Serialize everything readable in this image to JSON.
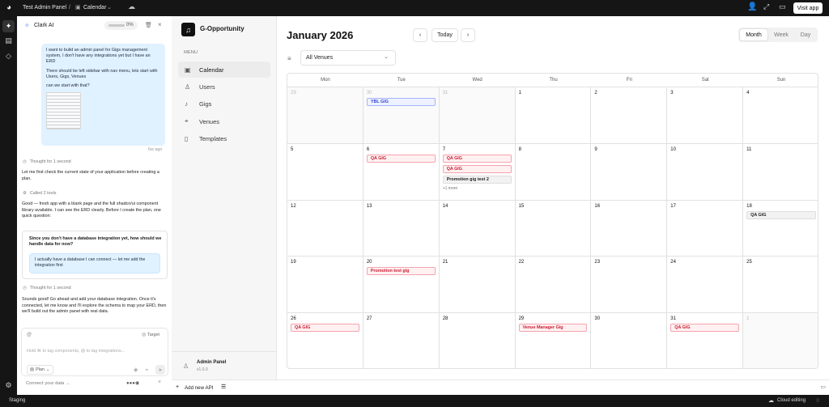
{
  "topbar": {
    "project": "Test Admin Panel",
    "separator": "/",
    "page": "Calendar",
    "visit_label": "Visit app"
  },
  "rail": {
    "icons": [
      "sparkle-icon",
      "message-icon",
      "code-icon",
      "settings-icon"
    ]
  },
  "chat": {
    "title": "Clark AI",
    "progress": "0%",
    "user_message": [
      "I want to build an admin panel for Gigs management system, I don't have any integrations yet but I have an ERD",
      "There should be left sidebar with nav menu, lets start with Users, Gigs, Venues",
      "can we start with that?"
    ],
    "user_time": "6w ago",
    "thought1": "Thought for 1 second",
    "assistant1": "Let me first check the current state of your application before creating a plan.",
    "tools": "Called 2 tools",
    "assistant2": "Good — fresh app with a blank page and the full shadcn/ui component library available. I can see the ERD clearly. Before I create the plan, one quick question:",
    "question": "Since you don't have a database integration yet, how should we handle data for now?",
    "answer": "I actually have a database I can connect — let me add the integration first",
    "thought2": "Thought for 1 second",
    "assistant3": "Sounds good! Go ahead and add your database integration. Once it's connected, let me know and I'll explore the schema to map your ERD, then we'll build out the admin panel with real data.",
    "input_at": "@",
    "target": "Target",
    "placeholder": "Hold ⌘ to tag components, @ to tag integrations...",
    "mode": "Plan",
    "connect": "Connect your data →"
  },
  "sidebar": {
    "brand": "G-Opportunity",
    "menu_label": "MENU",
    "items": [
      {
        "label": "Calendar",
        "icon": "calendar-icon"
      },
      {
        "label": "Users",
        "icon": "users-icon"
      },
      {
        "label": "Gigs",
        "icon": "music-icon"
      },
      {
        "label": "Venues",
        "icon": "location-icon"
      },
      {
        "label": "Templates",
        "icon": "file-icon"
      }
    ],
    "admin_title": "Admin Panel",
    "admin_version": "v1.0.0"
  },
  "calendar": {
    "month": "January 2026",
    "today": "Today",
    "views": [
      "Month",
      "Week",
      "Day"
    ],
    "venue_filter": "All Venues",
    "weekdays": [
      "Mon",
      "Tue",
      "Wed",
      "Thu",
      "Fri",
      "Sat",
      "Sun"
    ],
    "days": [
      {
        "n": "29",
        "out": true,
        "events": []
      },
      {
        "n": "30",
        "out": true,
        "events": [
          {
            "t": "YBL GIG",
            "c": "blue"
          }
        ]
      },
      {
        "n": "31",
        "out": true,
        "events": []
      },
      {
        "n": "1",
        "out": false,
        "events": []
      },
      {
        "n": "2",
        "out": false,
        "events": []
      },
      {
        "n": "3",
        "out": false,
        "events": []
      },
      {
        "n": "4",
        "out": false,
        "events": []
      },
      {
        "n": "5",
        "out": false,
        "events": []
      },
      {
        "n": "6",
        "out": false,
        "events": [
          {
            "t": "QA GIG",
            "c": "red"
          }
        ]
      },
      {
        "n": "7",
        "out": false,
        "events": [
          {
            "t": "QA GIG",
            "c": "red"
          },
          {
            "t": "QA GIG",
            "c": "red"
          },
          {
            "t": "Promotion gig test 2",
            "c": "gray"
          }
        ],
        "more": "+1 more"
      },
      {
        "n": "8",
        "out": false,
        "events": []
      },
      {
        "n": "9",
        "out": false,
        "events": []
      },
      {
        "n": "10",
        "out": false,
        "events": []
      },
      {
        "n": "11",
        "out": false,
        "events": []
      },
      {
        "n": "12",
        "out": false,
        "events": []
      },
      {
        "n": "13",
        "out": false,
        "events": []
      },
      {
        "n": "14",
        "out": false,
        "events": []
      },
      {
        "n": "15",
        "out": false,
        "events": []
      },
      {
        "n": "16",
        "out": false,
        "events": []
      },
      {
        "n": "17",
        "out": false,
        "events": []
      },
      {
        "n": "18",
        "out": false,
        "events": [
          {
            "t": "QA GIG",
            "c": "gray"
          }
        ]
      },
      {
        "n": "19",
        "out": false,
        "events": []
      },
      {
        "n": "20",
        "out": false,
        "events": [
          {
            "t": "Promotion test gig",
            "c": "red"
          }
        ]
      },
      {
        "n": "21",
        "out": false,
        "events": []
      },
      {
        "n": "22",
        "out": false,
        "events": []
      },
      {
        "n": "23",
        "out": false,
        "events": []
      },
      {
        "n": "24",
        "out": false,
        "events": []
      },
      {
        "n": "25",
        "out": false,
        "events": []
      },
      {
        "n": "26",
        "out": false,
        "events": [
          {
            "t": "QA GIG",
            "c": "red"
          }
        ]
      },
      {
        "n": "27",
        "out": false,
        "events": []
      },
      {
        "n": "28",
        "out": false,
        "events": []
      },
      {
        "n": "29",
        "out": false,
        "events": [
          {
            "t": "Venue Manager Gig",
            "c": "red"
          }
        ]
      },
      {
        "n": "30",
        "out": false,
        "events": []
      },
      {
        "n": "31",
        "out": false,
        "events": [
          {
            "t": "QA GIG",
            "c": "red"
          }
        ]
      },
      {
        "n": "1",
        "out": true,
        "events": []
      }
    ]
  },
  "footer": {
    "add_api": "Add new API",
    "staging": "Staging",
    "cloud": "Cloud editing"
  },
  "colors": {
    "blue_bg": "#eef2ff",
    "blue_border": "#a5b4fc",
    "blue_text": "#3446d3",
    "red_bg": "#fff1f2",
    "red_border": "#f5a3ad",
    "red_text": "#c81e32",
    "gray_bg": "#f2f2f2",
    "gray_border": "#dedede",
    "gray_text": "#222222"
  }
}
